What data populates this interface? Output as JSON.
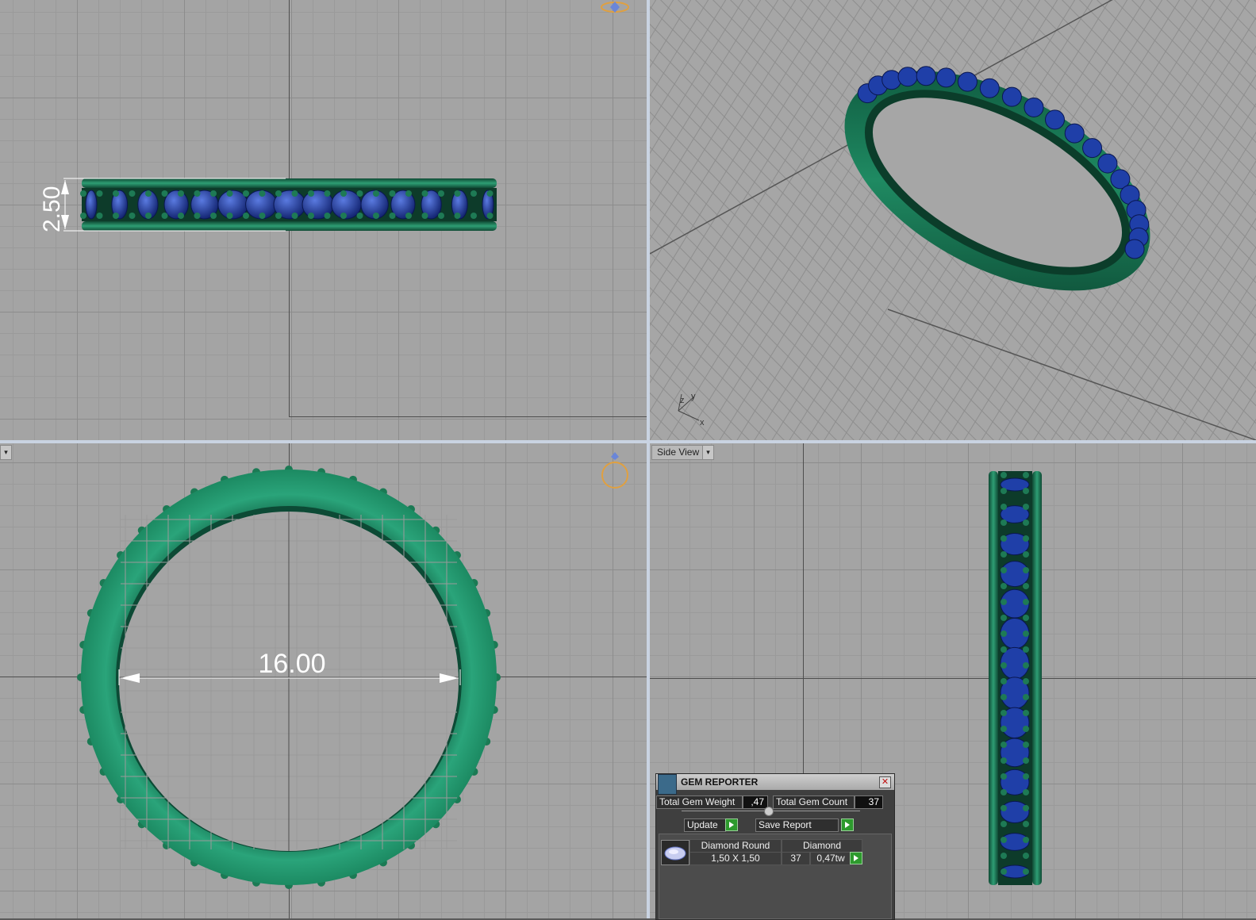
{
  "viewports": {
    "top_left_dimension": "2.50",
    "bottom_left_dimension": "16.00",
    "bottom_right_label": "Side View",
    "bottom_left_dropdown_arrow": "▾"
  },
  "axes_triad": {
    "z": "z",
    "y": "y",
    "x": "x"
  },
  "gem_reporter": {
    "title": "GEM REPORTER",
    "close": "✕",
    "total_gem_weight_label": "Total Gem Weight",
    "total_gem_weight_value": ",47",
    "total_gem_count_label": "Total Gem Count",
    "total_gem_count_value": "37",
    "update_label": "Update",
    "save_report_label": "Save Report",
    "rows": [
      {
        "shape": "Diamond Round",
        "material": "Diamond",
        "size": "1,50 X 1,50",
        "count": "37",
        "weight": "0,47tw"
      }
    ]
  },
  "colors": {
    "metal": "#2a9a70",
    "gem": "#1f3fa8",
    "grid_bg": "#a4a4a4",
    "dimension": "#ffffff"
  }
}
